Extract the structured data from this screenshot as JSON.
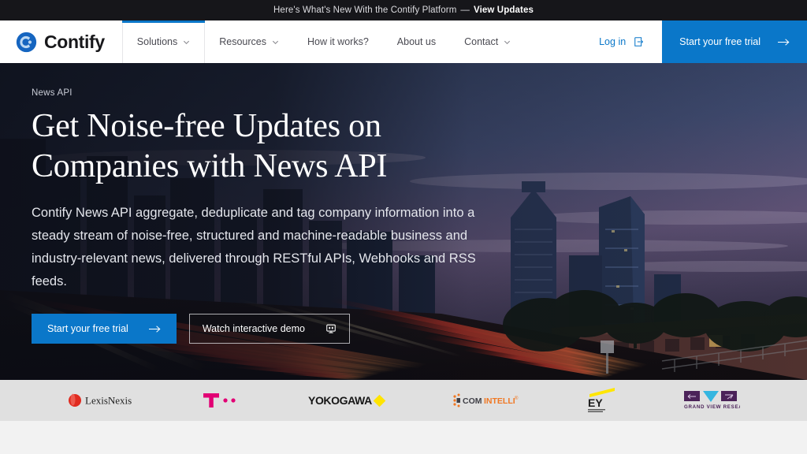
{
  "announcement": {
    "text": "Here's What's New With the Contify Platform",
    "dash": "—",
    "link_label": "View Updates"
  },
  "header": {
    "brand_name": "Contify",
    "brand_icon": "contify-circle-logo",
    "nav": [
      {
        "label": "Solutions",
        "has_caret": true,
        "active": true
      },
      {
        "label": "Resources",
        "has_caret": true,
        "active": false
      },
      {
        "label": "How it works?",
        "has_caret": false,
        "active": false
      },
      {
        "label": "About us",
        "has_caret": false,
        "active": false
      },
      {
        "label": "Contact",
        "has_caret": true,
        "active": false
      }
    ],
    "login_label": "Log in",
    "login_icon": "sign-in-icon",
    "cta_label": "Start your free trial",
    "cta_icon": "arrow-right-icon",
    "accent_color": "#0a77c9"
  },
  "hero": {
    "eyebrow": "News API",
    "title_line_1": "Get Noise-free Updates on",
    "title_line_2": "Companies with News API",
    "description": "Contify News API aggregate, deduplicate and tag company information into a steady stream of noise-free, structured and machine-readable business and industry-relevant news, delivered through RESTful APIs, Webhooks and RSS feeds.",
    "primary_cta": "Start your free trial",
    "primary_cta_icon": "arrow-right-icon",
    "secondary_cta": "Watch interactive demo",
    "secondary_cta_icon": "monitor-demo-icon",
    "background_image": "city-skyline-at-dusk-with-highway-light-trails"
  },
  "logo_strip": {
    "background_color": "#e0e0e0",
    "logos": [
      {
        "name": "LexisNexis",
        "icon": "lexisnexis-logo"
      },
      {
        "name": "T-Mobile",
        "icon": "t-mobile-logo"
      },
      {
        "name": "YOKOGAWA",
        "icon": "yokogawa-logo"
      },
      {
        "name": "Comintelli",
        "icon": "comintelli-logo"
      },
      {
        "name": "EY",
        "icon": "ey-logo"
      },
      {
        "name": "Grand View Research",
        "icon": "grand-view-research-logo"
      }
    ]
  }
}
